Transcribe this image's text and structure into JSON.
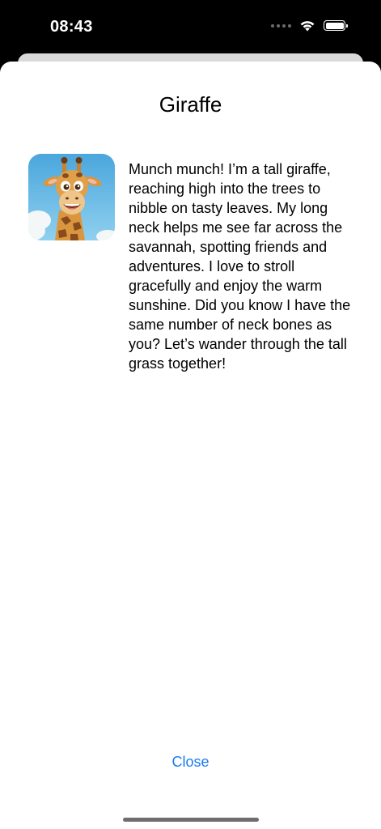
{
  "status_bar": {
    "time": "08:43",
    "icons": [
      "signal-dots-icon",
      "wifi-icon",
      "battery-icon"
    ]
  },
  "sheet": {
    "title": "Giraffe",
    "image_icon": "giraffe-icon",
    "description": "Munch munch! I’m a tall giraffe, reaching high into the trees to nibble on tasty leaves. My long neck helps me see far across the savannah, spotting friends and adventures. I love to stroll gracefully and enjoy the warm sunshine. Did you know I have the same number of neck bones as you? Let’s wander through the tall grass together!",
    "close_label": "Close"
  },
  "colors": {
    "accent": "#1a7cf0",
    "status_background": "#000000",
    "sheet_background": "#ffffff"
  }
}
